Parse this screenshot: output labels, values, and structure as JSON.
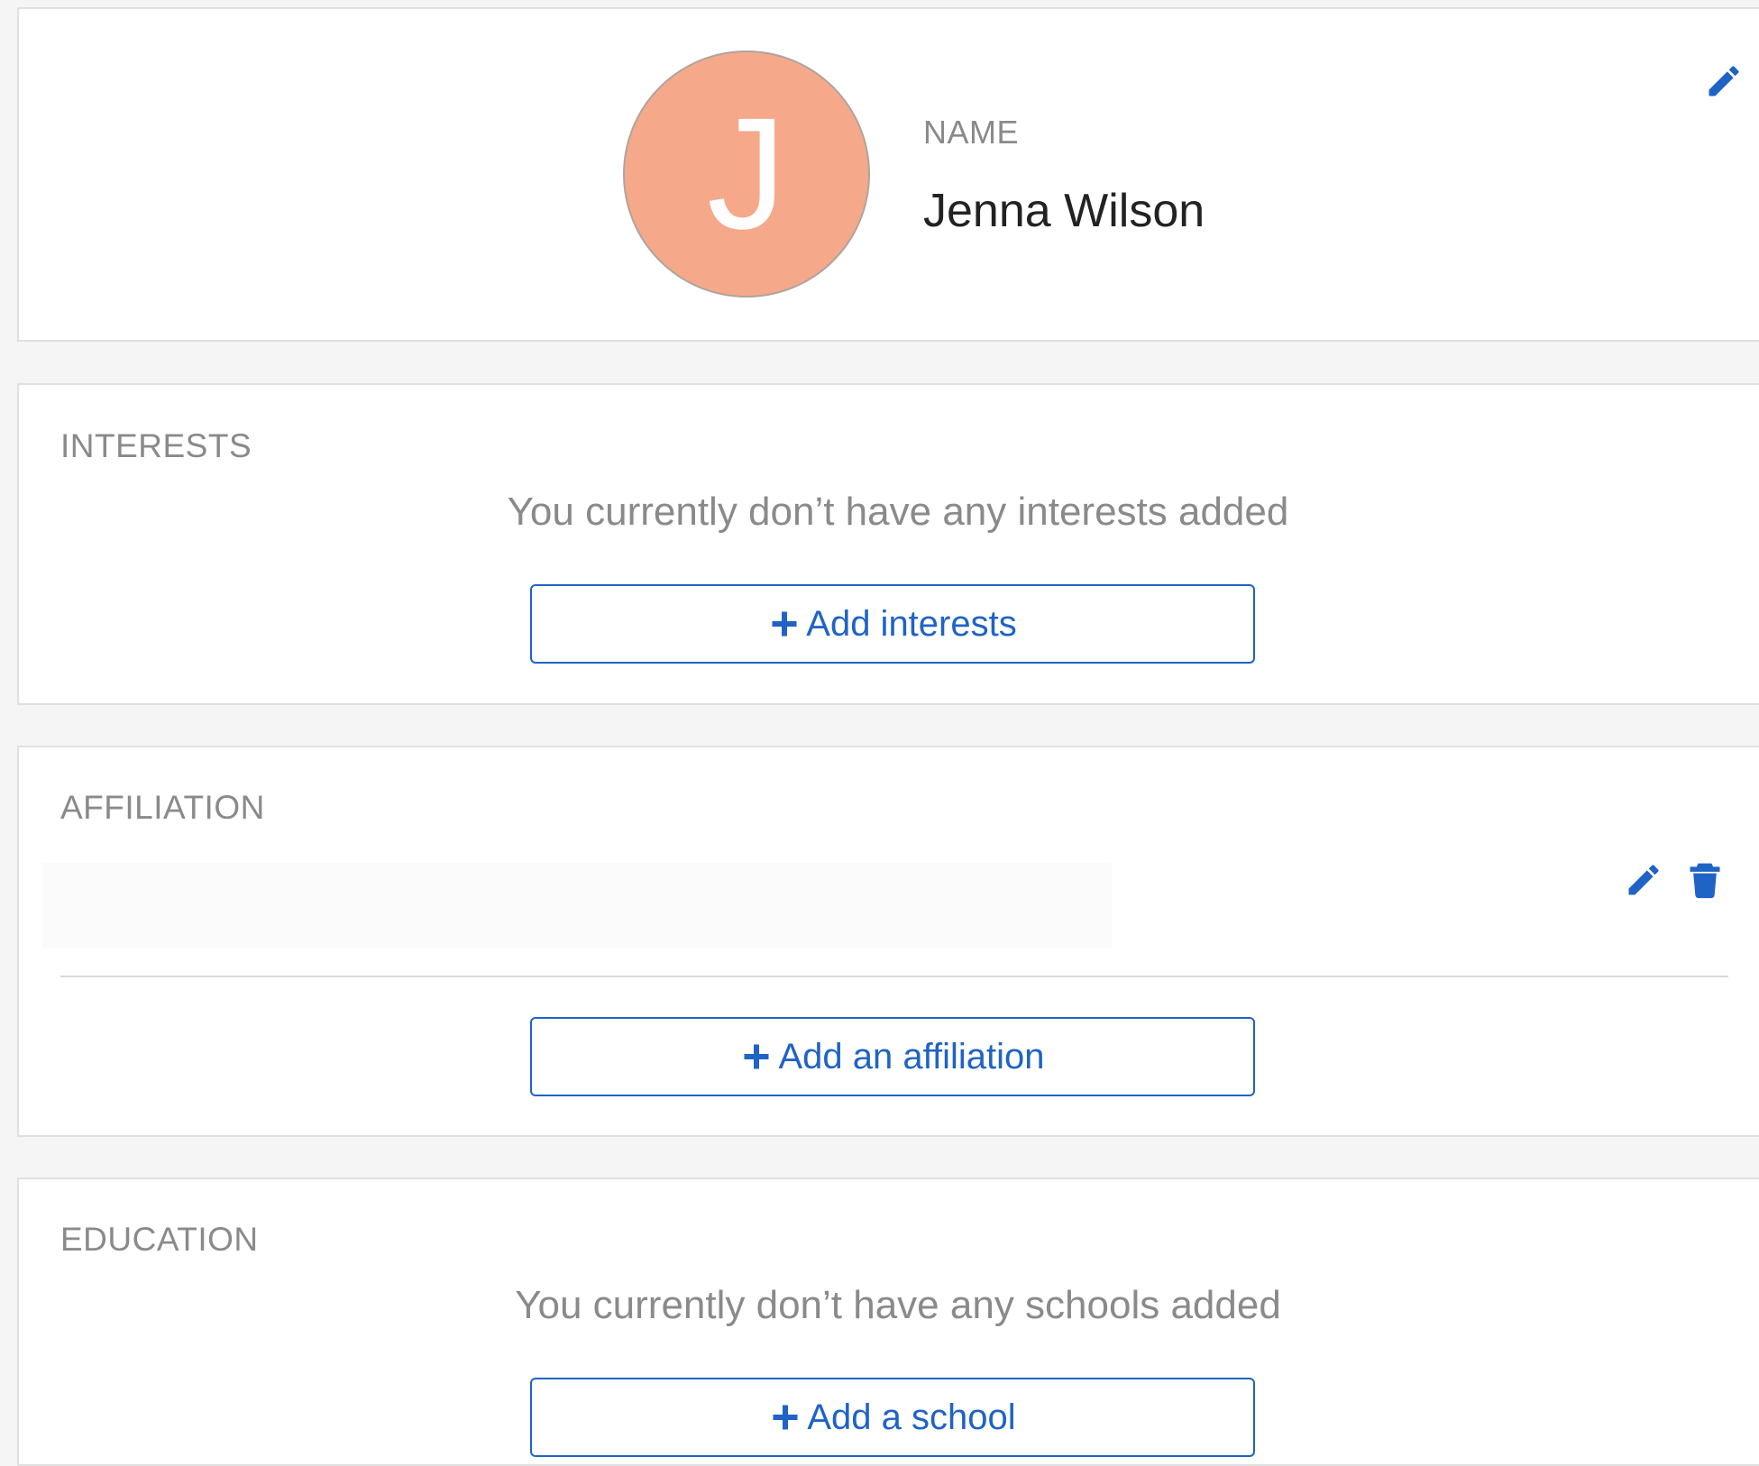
{
  "profile": {
    "avatar_initial": "J",
    "name_label": "NAME",
    "name_value": "Jenna Wilson",
    "avatar_color": "#f5a98a"
  },
  "interests": {
    "title": "INTERESTS",
    "empty_message": "You currently don’t have any interests added",
    "add_button_label": "Add interests"
  },
  "affiliation": {
    "title": "AFFILIATION",
    "add_button_label": "Add an affiliation"
  },
  "education": {
    "title": "EDUCATION",
    "empty_message": "You currently don’t have any schools added",
    "add_button_label": "Add a school"
  },
  "icons": {
    "edit": "pencil-icon",
    "delete": "trash-icon",
    "add": "plus-icon"
  },
  "colors": {
    "accent": "#1f63c5",
    "muted_text": "#8a8a8a",
    "border": "#e0e0e0"
  }
}
